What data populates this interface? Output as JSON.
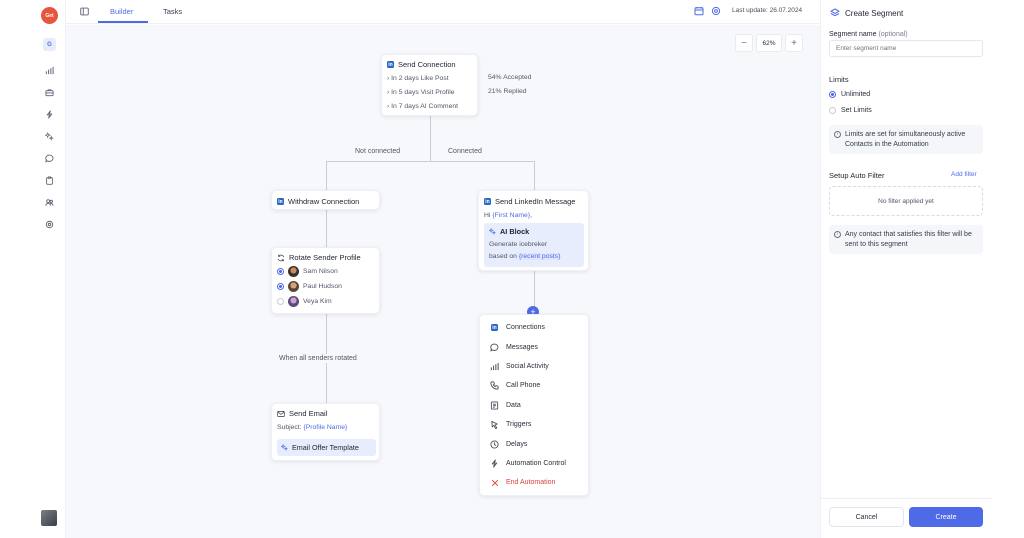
{
  "app": {
    "logo_text": "Get",
    "workspace_initial": "G"
  },
  "rail": {
    "icons": [
      "chart-icon",
      "briefcase-icon",
      "bolt-icon",
      "ai-icon",
      "chat-icon",
      "clipboard-icon",
      "users-icon",
      "settings-icon"
    ]
  },
  "topbar": {
    "tabs": [
      {
        "label": "Builder",
        "active": true
      },
      {
        "label": "Tasks",
        "active": false
      }
    ],
    "last_update": "Last update: 26.07.2024"
  },
  "zoom": {
    "minus": "−",
    "value": "62%",
    "plus": "+"
  },
  "flow": {
    "send_connection": {
      "title": "Send Connection",
      "steps": [
        "In 2 days Like Post",
        "In 5 days Visit Profile",
        "In 7 days AI Comment"
      ],
      "stats": [
        "54% Accepted",
        "21% Replied"
      ]
    },
    "branches": {
      "left": "Not connected",
      "right": "Connected"
    },
    "withdraw": {
      "title": "Withdraw Connection"
    },
    "rotate": {
      "title": "Rotate Sender Profile",
      "senders": [
        {
          "name": "Sam Nilson",
          "selected": true
        },
        {
          "name": "Paul Hudson",
          "selected": true
        },
        {
          "name": "Veya Kim",
          "selected": false
        }
      ]
    },
    "rotated_label": "When all senders rotated",
    "send_email": {
      "title": "Send Email",
      "subject_prefix": "Subject:",
      "subject_var": "{Profile Name}",
      "template": "Email Offer Template"
    },
    "linkedin_message": {
      "title": "Send LinkedIn Message",
      "greeting_prefix": "Hi",
      "greeting_var": "{First Name}",
      "greeting_suffix": ",",
      "ai_block_title": "AI Block",
      "ai_line1": "Generate icebreker",
      "ai_line2_prefix": "based on",
      "ai_line2_var": "{recent posts}"
    },
    "add_symbol": "+",
    "action_menu": [
      {
        "label": "Connections",
        "icon": "linkedin-icon"
      },
      {
        "label": "Messages",
        "icon": "chat-icon"
      },
      {
        "label": "Social Activity",
        "icon": "bar-chart-icon"
      },
      {
        "label": "Call Phone",
        "icon": "phone-icon"
      },
      {
        "label": "Data",
        "icon": "data-icon"
      },
      {
        "label": "Triggers",
        "icon": "trigger-icon"
      },
      {
        "label": "Delays",
        "icon": "clock-icon"
      },
      {
        "label": "Automation Control",
        "icon": "bolt-icon"
      },
      {
        "label": "End Automation",
        "icon": "close-icon",
        "danger": true
      }
    ]
  },
  "panel": {
    "title": "Create Segment",
    "name_label": "Segment name",
    "name_optional": "(optional)",
    "name_placeholder": "Enter segment name",
    "limits_title": "Limits",
    "limit_options": [
      {
        "label": "Unlimited",
        "selected": true
      },
      {
        "label": "Set Limits",
        "selected": false
      }
    ],
    "limits_note": "Limits are set for simultaneously active Contacts in the Automation",
    "filter_title": "Setup Auto Filter",
    "add_filter": "Add filter",
    "no_filter": "No filter applied yet",
    "filter_note": "Any contact that satisfies this filter will be sent to this segment",
    "cancel": "Cancel",
    "create": "Create"
  },
  "colors": {
    "accent": "#4f6ae6",
    "linkedin": "#2b67c7",
    "danger": "#d8443a",
    "logo": "#e8553e"
  }
}
